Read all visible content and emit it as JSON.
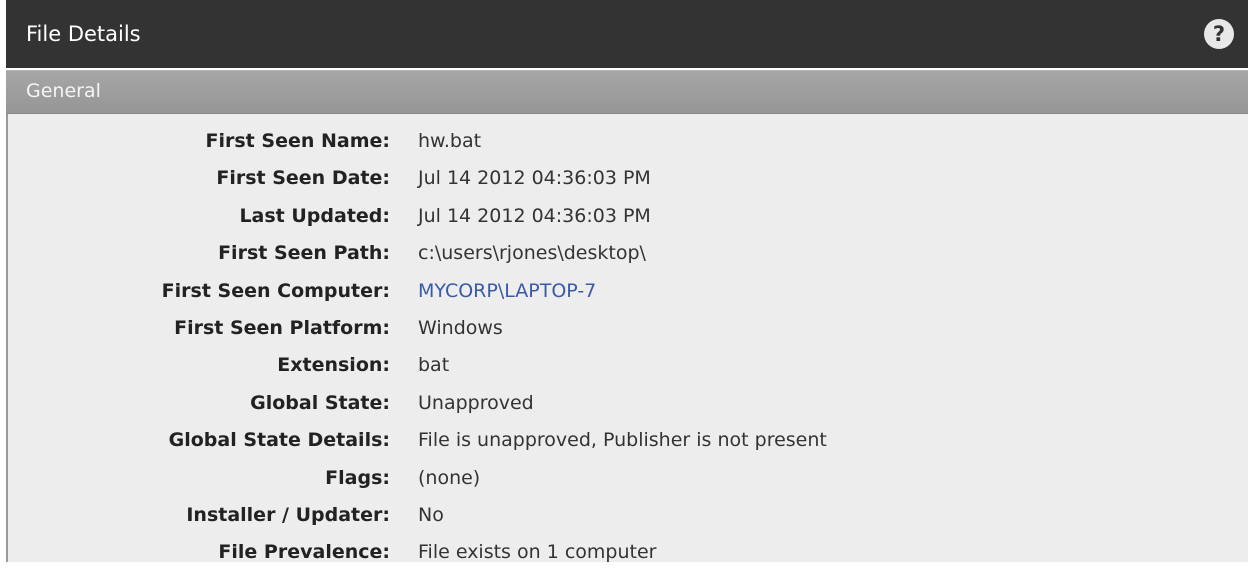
{
  "header": {
    "title": "File Details",
    "help_icon": "question-mark-icon",
    "help_glyph": "?"
  },
  "section": {
    "label": "General"
  },
  "details": [
    {
      "key": "First Seen Name:",
      "value": "hw.bat"
    },
    {
      "key": "First Seen Date:",
      "value": "Jul 14 2012 04:36:03 PM"
    },
    {
      "key": "Last Updated:",
      "value": "Jul 14 2012 04:36:03 PM"
    },
    {
      "key": "First Seen Path:",
      "value": "c:\\users\\rjones\\desktop\\"
    },
    {
      "key": "First Seen Computer:",
      "value": "MYCORP\\LAPTOP-7",
      "link": true
    },
    {
      "key": "First Seen Platform:",
      "value": "Windows"
    },
    {
      "key": "Extension:",
      "value": "bat"
    },
    {
      "key": "Global State:",
      "value": "Unapproved"
    },
    {
      "key": "Global State Details:",
      "value": "File is unapproved, Publisher is not present"
    },
    {
      "key": "Flags:",
      "value": "(none)"
    },
    {
      "key": "Installer / Updater:",
      "value": "No"
    },
    {
      "key": "File Prevalence:",
      "value": "File exists on 1 computer"
    }
  ],
  "colors": {
    "titlebar": "#333333",
    "section_header": "#a0a0a0",
    "content_bg": "#ededed",
    "link": "#3a5aa8"
  }
}
